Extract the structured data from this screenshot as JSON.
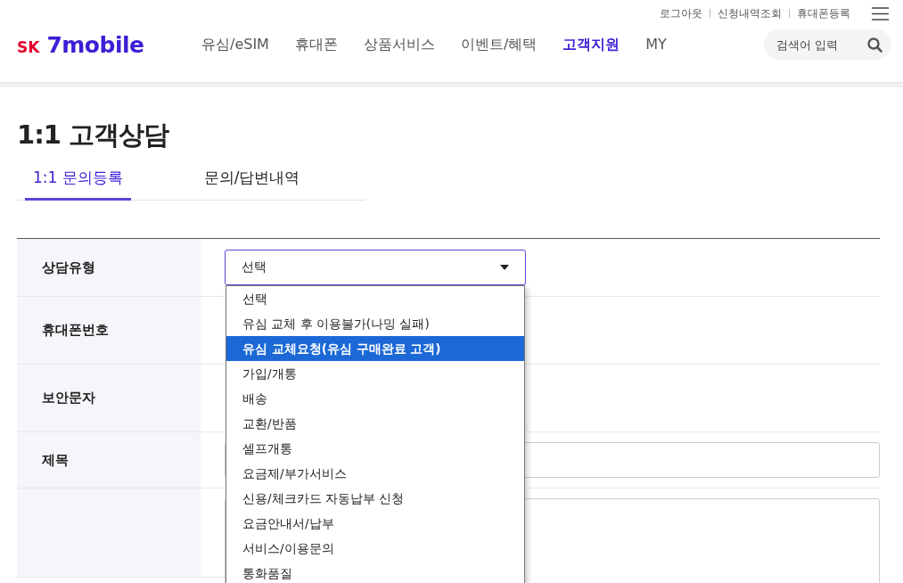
{
  "top_links": [
    "로그아웃",
    "신청내역조회",
    "휴대폰등록"
  ],
  "logo": {
    "brand": "SK",
    "name": "7mobile"
  },
  "nav": [
    {
      "label": "유심/eSIM",
      "selected": false
    },
    {
      "label": "휴대폰",
      "selected": false
    },
    {
      "label": "상품서비스",
      "selected": false
    },
    {
      "label": "이벤트/혜택",
      "selected": false
    },
    {
      "label": "고객지원",
      "selected": true
    },
    {
      "label": "MY",
      "selected": false
    }
  ],
  "search": {
    "placeholder": "검색어 입력"
  },
  "page_title": "1:1 고객상담",
  "tabs": [
    {
      "label": "1:1 문의등록",
      "selected": true
    },
    {
      "label": "문의/답변내역",
      "selected": false
    }
  ],
  "form": {
    "rows": [
      {
        "label": "상담유형",
        "kind": "select"
      },
      {
        "label": "휴대폰번호",
        "kind": "hidden"
      },
      {
        "label": "보안문자",
        "kind": "hidden"
      },
      {
        "label": "제목",
        "kind": "input"
      },
      {
        "label": "",
        "kind": "textarea"
      }
    ],
    "select_value": "선택",
    "dropdown": [
      {
        "label": "선택",
        "selected": false
      },
      {
        "label": "유심 교체 후 이용불가(나밍 실패)",
        "selected": false
      },
      {
        "label": "유심 교체요청(유심 구매완료 고객)",
        "selected": true
      },
      {
        "label": "가입/개통",
        "selected": false
      },
      {
        "label": "배송",
        "selected": false
      },
      {
        "label": "교환/반품",
        "selected": false
      },
      {
        "label": "셀프개통",
        "selected": false
      },
      {
        "label": "요금제/부가서비스",
        "selected": false
      },
      {
        "label": "신용/체크카드 자동납부 신청",
        "selected": false
      },
      {
        "label": "요금안내서/납부",
        "selected": false
      },
      {
        "label": "서비스/이용문의",
        "selected": false
      },
      {
        "label": "통화품질",
        "selected": false
      }
    ]
  }
}
